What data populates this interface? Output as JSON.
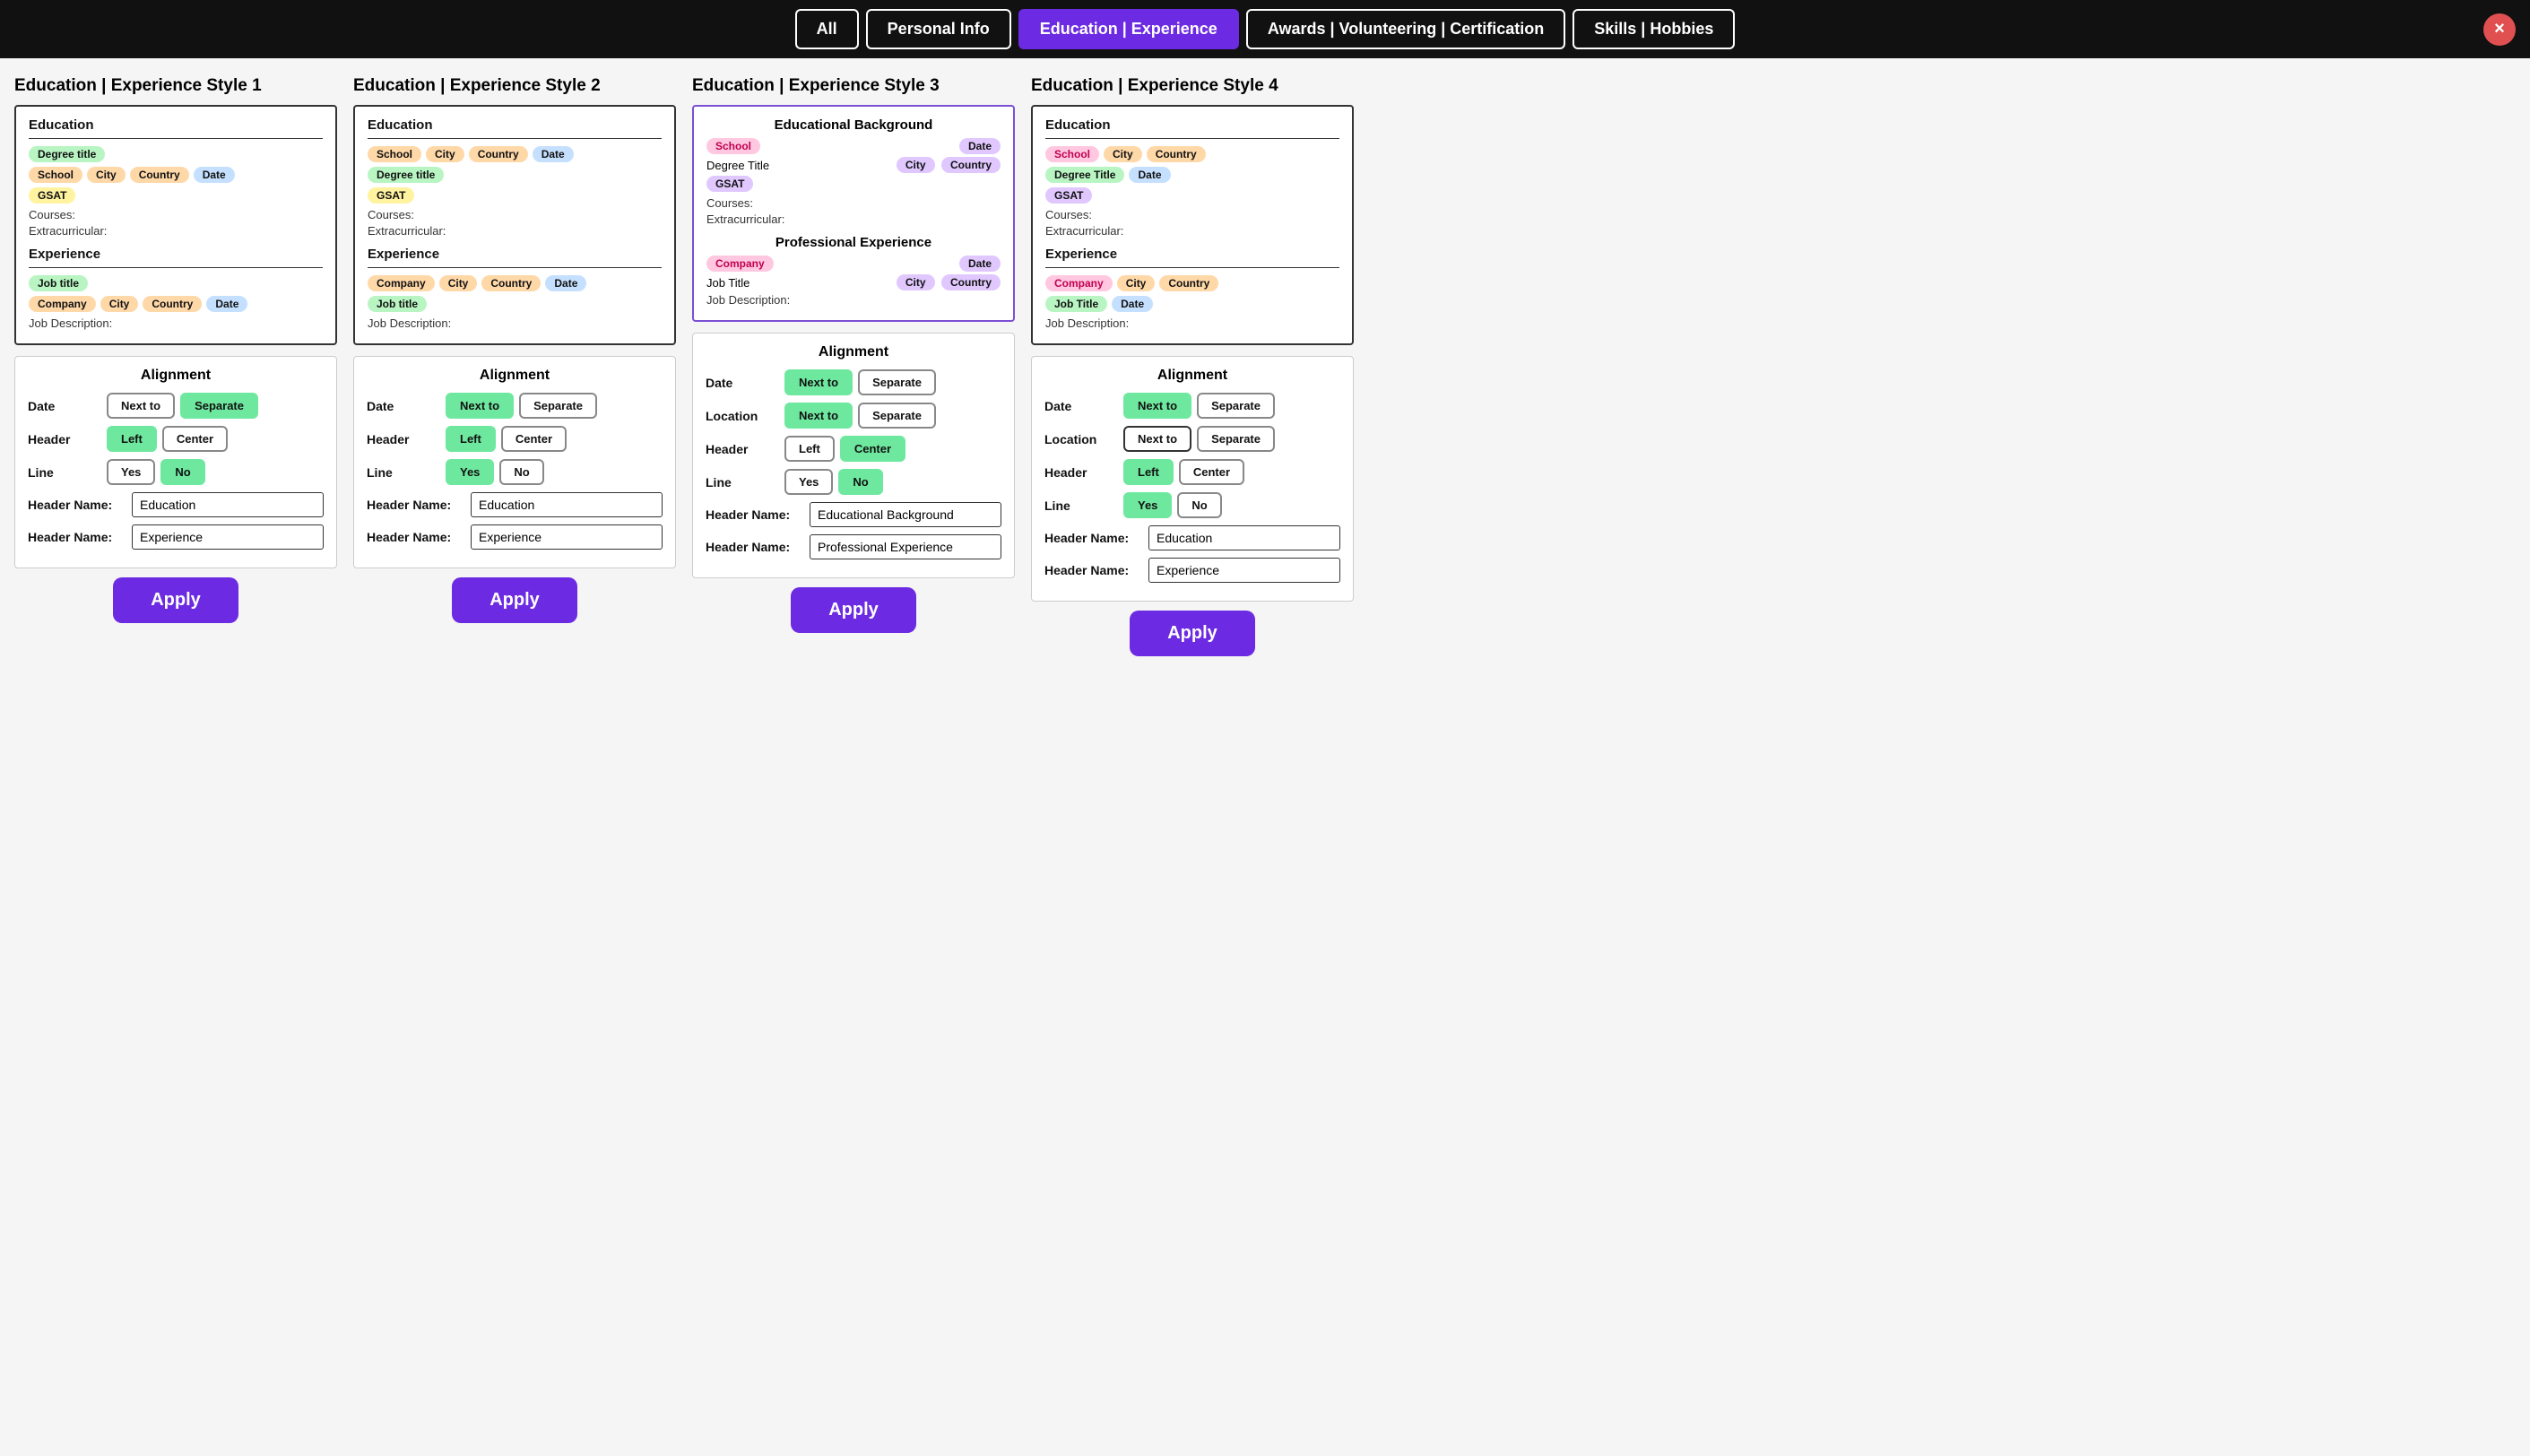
{
  "nav": {
    "buttons": [
      {
        "label": "All",
        "active": false
      },
      {
        "label": "Personal Info",
        "active": false
      },
      {
        "label": "Education | Experience",
        "active": true
      },
      {
        "label": "Awards | Volunteering | Certification",
        "active": false
      },
      {
        "label": "Skills | Hobbies",
        "active": false
      }
    ],
    "close_label": "×"
  },
  "styles": [
    {
      "title": "Education | Experience Style 1",
      "education_header": "Education",
      "education_fields": [
        {
          "type": "tag",
          "color": "green",
          "text": "Degree title"
        },
        {
          "type": "tag-row",
          "tags": [
            {
              "color": "orange",
              "text": "School"
            },
            {
              "color": "orange",
              "text": "City"
            },
            {
              "color": "orange",
              "text": "Country"
            },
            {
              "color": "blue",
              "text": "Date"
            }
          ]
        },
        {
          "type": "tag",
          "color": "yellow",
          "text": "GSAT"
        },
        {
          "type": "label",
          "text": "Courses:"
        },
        {
          "type": "label",
          "text": "Extracurricular:"
        }
      ],
      "experience_header": "Experience",
      "experience_fields": [
        {
          "type": "tag",
          "color": "green",
          "text": "Job title"
        },
        {
          "type": "tag-row",
          "tags": [
            {
              "color": "orange",
              "text": "Company"
            },
            {
              "color": "orange",
              "text": "City"
            },
            {
              "color": "orange",
              "text": "Country"
            },
            {
              "color": "blue",
              "text": "Date"
            }
          ]
        },
        {
          "type": "label",
          "text": "Job Description:"
        }
      ],
      "alignment": {
        "title": "Alignment",
        "date": {
          "label": "Date",
          "options": [
            "Next to",
            "Separate"
          ],
          "active": "Separate"
        },
        "header": {
          "label": "Header",
          "options": [
            "Left",
            "Center"
          ],
          "active": "Left"
        },
        "line": {
          "label": "Line",
          "options": [
            "Yes",
            "No"
          ],
          "active": "No"
        },
        "header_names": [
          {
            "label": "Header Name:",
            "value": "Education"
          },
          {
            "label": "Header Name:",
            "value": "Experience"
          }
        ]
      },
      "apply_label": "Apply"
    },
    {
      "title": "Education | Experience Style 2",
      "education_header": "Education",
      "education_fields": [
        {
          "type": "tag-row",
          "tags": [
            {
              "color": "orange",
              "text": "School"
            },
            {
              "color": "orange",
              "text": "City"
            },
            {
              "color": "orange",
              "text": "Country"
            },
            {
              "color": "blue",
              "text": "Date"
            }
          ]
        },
        {
          "type": "tag",
          "color": "green",
          "text": "Degree title"
        },
        {
          "type": "tag",
          "color": "yellow",
          "text": "GSAT"
        },
        {
          "type": "label",
          "text": "Courses:"
        },
        {
          "type": "label",
          "text": "Extracurricular:"
        }
      ],
      "experience_header": "Experience",
      "experience_fields": [
        {
          "type": "tag-row",
          "tags": [
            {
              "color": "orange",
              "text": "Company"
            },
            {
              "color": "orange",
              "text": "City"
            },
            {
              "color": "orange",
              "text": "Country"
            },
            {
              "color": "blue",
              "text": "Date"
            }
          ]
        },
        {
          "type": "tag",
          "color": "green",
          "text": "Job title"
        },
        {
          "type": "label",
          "text": "Job Description:"
        }
      ],
      "alignment": {
        "title": "Alignment",
        "date": {
          "label": "Date",
          "options": [
            "Next to",
            "Separate"
          ],
          "active": "Next to"
        },
        "header": {
          "label": "Header",
          "options": [
            "Left",
            "Center"
          ],
          "active": "Left"
        },
        "line": {
          "label": "Line",
          "options": [
            "Yes",
            "No"
          ],
          "active": "Yes"
        },
        "header_names": [
          {
            "label": "Header Name:",
            "value": "Education"
          },
          {
            "label": "Header Name:",
            "value": "Experience"
          }
        ]
      },
      "apply_label": "Apply"
    },
    {
      "title": "Education | Experience Style 3",
      "education_header": "Educational Background",
      "education_header_center": true,
      "education_fields": [
        {
          "type": "right-row",
          "left": {
            "color": "red",
            "text": "School"
          },
          "right": {
            "color": "purple",
            "text": "Date"
          }
        },
        {
          "type": "right-row2",
          "left": {
            "text": "Degree Title"
          },
          "right_tags": [
            {
              "color": "purple",
              "text": "City"
            },
            {
              "color": "purple",
              "text": "Country"
            }
          ]
        },
        {
          "type": "tag",
          "color": "purple",
          "text": "GSAT"
        },
        {
          "type": "label",
          "text": "Courses:"
        },
        {
          "type": "label",
          "text": "Extracurricular:"
        }
      ],
      "experience_header": "Professional Experience",
      "experience_header_center": true,
      "experience_fields": [
        {
          "type": "right-row",
          "left": {
            "color": "red",
            "text": "Company"
          },
          "right": {
            "color": "purple",
            "text": "Date"
          }
        },
        {
          "type": "right-row2",
          "left": {
            "text": "Job Title"
          },
          "right_tags": [
            {
              "color": "purple",
              "text": "City"
            },
            {
              "color": "purple",
              "text": "Country"
            }
          ]
        },
        {
          "type": "label",
          "text": "Job Description:"
        }
      ],
      "alignment": {
        "title": "Alignment",
        "date": {
          "label": "Date",
          "options": [
            "Next to",
            "Separate"
          ],
          "active": "Next to"
        },
        "location": {
          "label": "Location",
          "options": [
            "Next to",
            "Separate"
          ],
          "active": "Next to"
        },
        "header": {
          "label": "Header",
          "options": [
            "Left",
            "Center"
          ],
          "active": "Center"
        },
        "line": {
          "label": "Line",
          "options": [
            "Yes",
            "No"
          ],
          "active": "No"
        },
        "header_names": [
          {
            "label": "Header Name:",
            "value": "Educational Background"
          },
          {
            "label": "Header Name:",
            "value": "Professional Experience"
          }
        ]
      },
      "apply_label": "Apply"
    },
    {
      "title": "Education | Experience Style 4",
      "education_header": "Education",
      "education_header_center": false,
      "education_fields": [
        {
          "type": "tag-row",
          "tags": [
            {
              "color": "red",
              "text": "School"
            },
            {
              "color": "orange",
              "text": "City"
            },
            {
              "color": "orange",
              "text": "Country"
            }
          ]
        },
        {
          "type": "tag-row",
          "tags": [
            {
              "color": "green",
              "text": "Degree Title"
            },
            {
              "color": "blue",
              "text": "Date"
            }
          ]
        },
        {
          "type": "tag",
          "color": "purple",
          "text": "GSAT"
        },
        {
          "type": "label",
          "text": "Courses:"
        },
        {
          "type": "label",
          "text": "Extracurricular:"
        }
      ],
      "experience_header": "Experience",
      "experience_header_center": false,
      "experience_fields": [
        {
          "type": "tag-row",
          "tags": [
            {
              "color": "red",
              "text": "Company"
            },
            {
              "color": "orange",
              "text": "City"
            },
            {
              "color": "orange",
              "text": "Country"
            }
          ]
        },
        {
          "type": "tag-row",
          "tags": [
            {
              "color": "green",
              "text": "Job Title"
            },
            {
              "color": "blue",
              "text": "Date"
            }
          ]
        },
        {
          "type": "label",
          "text": "Job Description:"
        }
      ],
      "alignment": {
        "title": "Alignment",
        "date": {
          "label": "Date",
          "options": [
            "Next to",
            "Separate"
          ],
          "active": "Next to"
        },
        "location": {
          "label": "Location",
          "options": [
            "Next to",
            "Separate"
          ],
          "active": "Next to"
        },
        "header": {
          "label": "Header",
          "options": [
            "Left",
            "Center"
          ],
          "active": "Left"
        },
        "line": {
          "label": "Line",
          "options": [
            "Yes",
            "No"
          ],
          "active": "Yes"
        },
        "header_names": [
          {
            "label": "Header Name:",
            "value": "Education"
          },
          {
            "label": "Header Name:",
            "value": "Experience"
          }
        ]
      },
      "apply_label": "Apply"
    }
  ]
}
